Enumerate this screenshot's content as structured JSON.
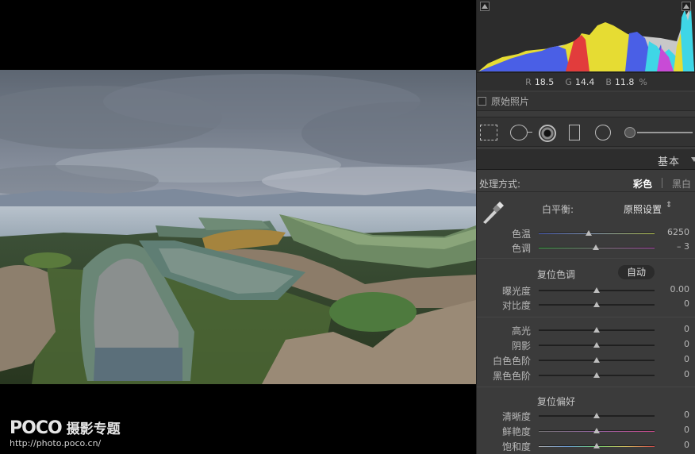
{
  "watermark": {
    "brand": "POCO",
    "topic": "摄影专题",
    "url": "http://photo.poco.cn/"
  },
  "histogram": {
    "readout": {
      "r_label": "R",
      "r": "18.5",
      "g_label": "G",
      "g": "14.4",
      "b_label": "B",
      "b": "11.8",
      "unit": "%"
    },
    "colors": {
      "red": "#e23c3c",
      "green": "#3fc24a",
      "blue": "#4a5fe6",
      "yellow": "#e6dc33",
      "cyan": "#3fd6e6",
      "magenta": "#c84bd6",
      "luminance": "#c8c8c8"
    }
  },
  "original_photo": {
    "label": "原始照片"
  },
  "tools": [
    "crop-overlay",
    "spot-removal",
    "red-eye-correction",
    "graduated-filter",
    "radial-filter",
    "adjustment-brush"
  ],
  "section": {
    "title": "基本"
  },
  "treatment": {
    "label": "处理方式:",
    "color": "彩色",
    "bw": "黑白"
  },
  "white_balance": {
    "label": "白平衡:",
    "preset": "原照设置",
    "updown": "⇕"
  },
  "sliders": {
    "temp": {
      "label": "色温",
      "value": "6250",
      "position": 0.43
    },
    "tint": {
      "label": "色调",
      "value": "– 3",
      "position": 0.49
    },
    "exposure": {
      "label": "曝光度",
      "value": "0.00",
      "position": 0.5
    },
    "contrast": {
      "label": "对比度",
      "value": "0",
      "position": 0.5
    },
    "highlights": {
      "label": "高光",
      "value": "0",
      "position": 0.5
    },
    "shadows": {
      "label": "阴影",
      "value": "0",
      "position": 0.5
    },
    "whites": {
      "label": "白色色阶",
      "value": "0",
      "position": 0.5
    },
    "blacks": {
      "label": "黑色色阶",
      "value": "0",
      "position": 0.5
    },
    "clarity": {
      "label": "清晰度",
      "value": "0",
      "position": 0.5
    },
    "vibrance": {
      "label": "鲜艳度",
      "value": "0",
      "position": 0.5
    },
    "saturation": {
      "label": "饱和度",
      "value": "0",
      "position": 0.5
    }
  },
  "tone": {
    "label": "复位色调",
    "auto": "自动"
  },
  "presence": {
    "label": "复位偏好"
  }
}
